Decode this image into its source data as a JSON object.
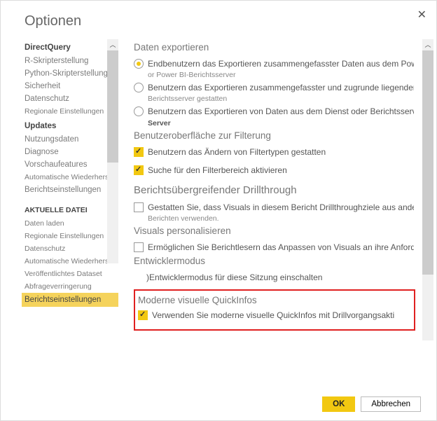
{
  "dialog": {
    "title": "Optionen"
  },
  "sidebar": {
    "g0": "DirectQuery",
    "i0": "R-Skripterstellung",
    "i1": "Python-Skripterstellung",
    "i2": "Sicherheit",
    "i3": "Datenschutz",
    "i4": "Regionale Einstellungen",
    "g1": "Updates",
    "i5": "Nutzungsdaten",
    "i6": "Diagnose",
    "i7": "Vorschaufeatures",
    "i8": "Automatische Wiederherstellung",
    "i9": "Berichtseinstellungen",
    "g2": "AKTUELLE DATEI",
    "i10": "Daten laden",
    "i11": "Regionale Einstellungen",
    "i12": "Datenschutz",
    "i13": "Automatische Wiederherstellung",
    "i14": "Veröffentlichtes Dataset",
    "i15": "Abfrageverringerung",
    "i16": "Berichtseinstellungen"
  },
  "content": {
    "export_title": "Daten exportieren",
    "r0": "Endbenutzern das Exportieren zusammengefasster Daten aus dem Powe",
    "r0_sub": "or Power BI-Berichtsserver",
    "r1": "Benutzern das Exportieren zusammengefasster und zugrunde liegender Da",
    "r1_sub": "Berichtsserver gestatten",
    "r2": "Benutzern das Exportieren von Daten aus dem Dienst oder Berichtsserver",
    "r2_sub": "Server",
    "filter_title": "Benutzeroberfläche zur Filterung",
    "c0": "Benutzern das Ändern von Filtertypen gestatten",
    "c1": "Suche für den Filterbereich aktivieren",
    "drill_title": "Berichtsübergreifender Drillthrough",
    "c2": "Gestatten Sie, dass Visuals in diesem Bericht Drillthroughziele aus andere",
    "c2_sub": "Berichten verwenden.",
    "visuals_title": "Visuals personalisieren",
    "c3": "Ermöglichen Sie Berichtlesern das Anpassen von Visuals an ihre Anforderu",
    "dev_title": "Entwicklermodus",
    "c4": ")Entwicklermodus für diese Sitzung einschalten",
    "tooltip_title": "Moderne visuelle QuickInfos",
    "c5": "Verwenden Sie moderne visuelle QuickInfos mit Drillvorgangsaktionen und"
  },
  "footer": {
    "ok": "OK",
    "cancel": "Abbrechen"
  }
}
